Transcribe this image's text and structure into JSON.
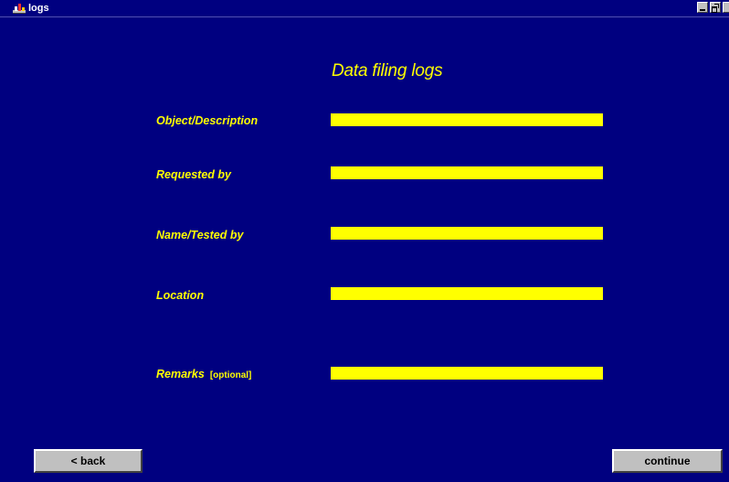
{
  "window": {
    "title": "logs",
    "background_color": "#000080",
    "accent_color": "#ffff00"
  },
  "titlebar": {
    "app_icon": "app-icon",
    "minimize_icon": "minimize-icon",
    "maximize_icon": "maximize-icon",
    "close_icon": "close-icon"
  },
  "form": {
    "heading": "Data filing logs",
    "fields": [
      {
        "label": "Object/Description",
        "note": "",
        "value": ""
      },
      {
        "label": "Requested by",
        "note": "",
        "value": ""
      },
      {
        "label": "Name/Tested by",
        "note": "",
        "value": ""
      },
      {
        "label": "Location",
        "note": "",
        "value": ""
      },
      {
        "label": "Remarks",
        "note": "[optional]",
        "value": ""
      }
    ]
  },
  "footer": {
    "back_label": "< back",
    "continue_label": "continue"
  }
}
